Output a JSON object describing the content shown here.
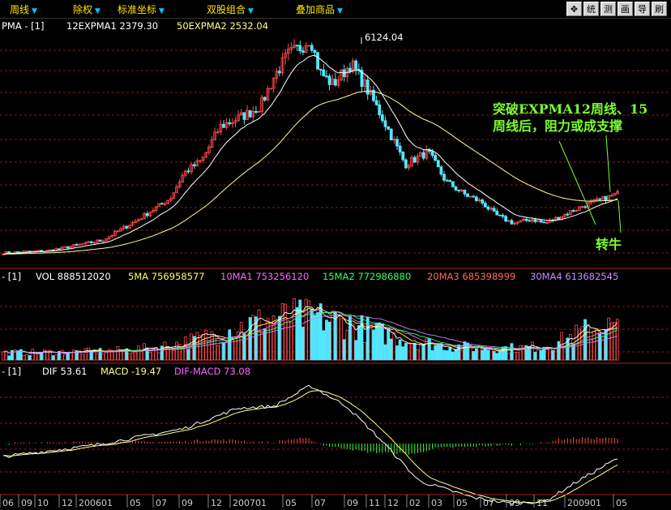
{
  "toolbar": {
    "menus": [
      {
        "label": "周线"
      },
      {
        "label": "除权"
      },
      {
        "label": "标准坐标"
      },
      {
        "label": "双股组合"
      },
      {
        "label": "叠加商品"
      }
    ],
    "buttons": [
      "统",
      "测",
      "画",
      "导",
      "刷"
    ],
    "move_icon": "move-cross-icon"
  },
  "colors": {
    "up": "#ff4a4a",
    "down": "#55e6ff",
    "expma1": "#ffffff",
    "expma2": "#ffff88",
    "ma5": "#ffffff",
    "ma10": "#ffff55",
    "ma15": "#ff66ff",
    "ma20": "#33ff66",
    "ma30": "#cc88ff",
    "grid": "#8a1a1a",
    "annotation": "#7cff2e",
    "dif": "#ffffff",
    "dea": "#ffff88"
  },
  "main": {
    "prefix": "PMA - [1]",
    "indicators": [
      {
        "label": "12EXPMA1",
        "value": "2379.30"
      },
      {
        "label": "50EXPMA2",
        "value": "2532.04"
      }
    ],
    "peak_label": "6124.04",
    "annotation_lines": [
      "突破EXPMA12周线、15",
      "周线后，阻力或成支撑"
    ],
    "annotation_2": "转牛"
  },
  "volume": {
    "prefix": "- [1]",
    "indicators": [
      {
        "label": "VOL",
        "value": "888512020"
      },
      {
        "label": "5MA",
        "value": "756958577"
      },
      {
        "label": "10MA1",
        "value": "753256120"
      },
      {
        "label": "15MA2",
        "value": "772986880"
      },
      {
        "label": "20MA3",
        "value": "685398999"
      },
      {
        "label": "30MA4",
        "value": "613682545"
      }
    ]
  },
  "macd": {
    "prefix": "- [1]",
    "indicators": [
      {
        "label": "DIF",
        "value": "53.61"
      },
      {
        "label": "MACD",
        "value": "-19.47"
      },
      {
        "label": "DIF-MACD",
        "value": "73.08"
      }
    ]
  },
  "xaxis": {
    "ticks": [
      "06",
      "09",
      "10",
      "12",
      "200601",
      "05",
      "07",
      "09",
      "12",
      "200701",
      "05",
      "07",
      "09",
      "11",
      "12",
      "02",
      "03",
      "05",
      "07",
      "09",
      "11",
      "200901",
      "05"
    ]
  },
  "chart_data": {
    "type": "candlestick",
    "title": "",
    "price_anchors": [
      {
        "t": 0,
        "p": 1000
      },
      {
        "t": 50,
        "p": 1050
      },
      {
        "t": 110,
        "p": 1300
      },
      {
        "t": 150,
        "p": 1800
      },
      {
        "t": 185,
        "p": 2300
      },
      {
        "t": 200,
        "p": 2900
      },
      {
        "t": 220,
        "p": 3200
      },
      {
        "t": 240,
        "p": 4000
      },
      {
        "t": 270,
        "p": 4300
      },
      {
        "t": 285,
        "p": 4500
      },
      {
        "t": 300,
        "p": 5200
      },
      {
        "t": 315,
        "p": 5700
      },
      {
        "t": 330,
        "p": 5900
      },
      {
        "t": 340,
        "p": 6124
      },
      {
        "t": 350,
        "p": 5300
      },
      {
        "t": 365,
        "p": 5000
      },
      {
        "t": 385,
        "p": 5500
      },
      {
        "t": 400,
        "p": 5000
      },
      {
        "t": 420,
        "p": 4200
      },
      {
        "t": 445,
        "p": 3100
      },
      {
        "t": 470,
        "p": 3400
      },
      {
        "t": 490,
        "p": 2700
      },
      {
        "t": 510,
        "p": 2400
      },
      {
        "t": 530,
        "p": 2200
      },
      {
        "t": 545,
        "p": 1900
      },
      {
        "t": 565,
        "p": 1700
      },
      {
        "t": 585,
        "p": 1800
      },
      {
        "t": 600,
        "p": 1700
      },
      {
        "t": 620,
        "p": 1900
      },
      {
        "t": 640,
        "p": 2100
      },
      {
        "t": 660,
        "p": 2250
      },
      {
        "t": 680,
        "p": 2400
      }
    ],
    "macd_anchors": [
      {
        "t": 0,
        "v": -70
      },
      {
        "t": 100,
        "v": -10
      },
      {
        "t": 200,
        "v": 80
      },
      {
        "t": 260,
        "v": 190
      },
      {
        "t": 300,
        "v": 200
      },
      {
        "t": 340,
        "v": 310
      },
      {
        "t": 380,
        "v": 200
      },
      {
        "t": 420,
        "v": 10
      },
      {
        "t": 460,
        "v": -200
      },
      {
        "t": 520,
        "v": -290
      },
      {
        "t": 560,
        "v": -320
      },
      {
        "t": 600,
        "v": -310
      },
      {
        "t": 640,
        "v": -190
      },
      {
        "t": 680,
        "v": -80
      }
    ],
    "weeks": 210
  }
}
